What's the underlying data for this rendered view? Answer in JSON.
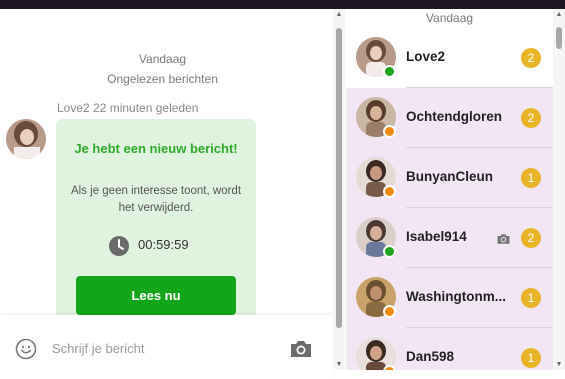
{
  "chat": {
    "day_label": "Vandaag",
    "unread_label": "Ongelezen berichten",
    "sender_line": "Love2 22 minuten geleden",
    "message": {
      "title": "Je hebt een nieuw bericht!",
      "text": "Als je geen interesse toont, wordt het verwijderd.",
      "timer": "00:59:59",
      "button_label": "Lees nu"
    },
    "composer": {
      "placeholder": "Schrijf je bericht",
      "emoji_icon": "smiley-icon",
      "camera_icon": "camera-icon"
    }
  },
  "conversation_list": {
    "header": "Vandaag",
    "items": [
      {
        "name": "Love2",
        "badge": "2",
        "status": "online",
        "has_photo_icon": false,
        "active": true
      },
      {
        "name": "Ochtendgloren",
        "badge": "2",
        "status": "away",
        "has_photo_icon": false,
        "active": false
      },
      {
        "name": "BunyanCleun",
        "badge": "1",
        "status": "away",
        "has_photo_icon": false,
        "active": false
      },
      {
        "name": "Isabel914",
        "badge": "2",
        "status": "online",
        "has_photo_icon": true,
        "active": false
      },
      {
        "name": "Washingtonm...",
        "badge": "1",
        "status": "away",
        "has_photo_icon": false,
        "active": false
      },
      {
        "name": "Dan598",
        "badge": "1",
        "status": "away",
        "has_photo_icon": false,
        "active": false
      }
    ]
  },
  "colors": {
    "accent_green": "#12a51a",
    "title_green": "#2faa2a",
    "bubble_bg": "#dff3df",
    "badge": "#e8b428",
    "online": "#1ea31e",
    "away": "#f08a10",
    "list_bg": "#f2e6f4"
  }
}
